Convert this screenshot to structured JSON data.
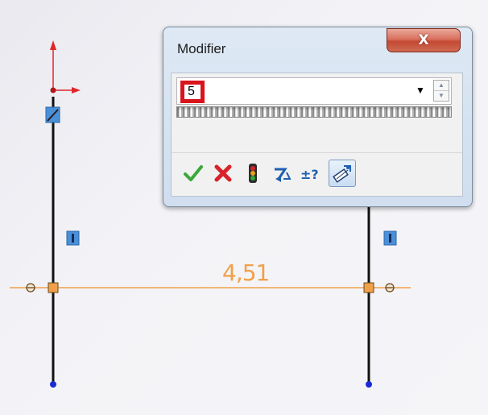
{
  "sketch": {
    "dimension_value": "4,51"
  },
  "modifier_dialog": {
    "title": "Modifier",
    "close_label": "X",
    "input_value": "5",
    "toolbar": [
      {
        "name": "ok-icon",
        "color": "#3aa83a"
      },
      {
        "name": "cancel-icon",
        "color": "#d8232a"
      },
      {
        "name": "rebuild-icon",
        "color": "#2e7d32"
      },
      {
        "name": "reverse-dimension-icon",
        "color": "#1f5fb0"
      },
      {
        "name": "increment-icon",
        "color": "#1f5fb0"
      },
      {
        "name": "mark-for-drawing-icon",
        "color": "#1f5fb0"
      }
    ]
  },
  "colors": {
    "dimension": "#f0a04a",
    "sketch_line": "#111111",
    "endpoint": "#1a2ad8",
    "origin_axes": "#e0262a",
    "relation_marker": "#4a90d9"
  }
}
